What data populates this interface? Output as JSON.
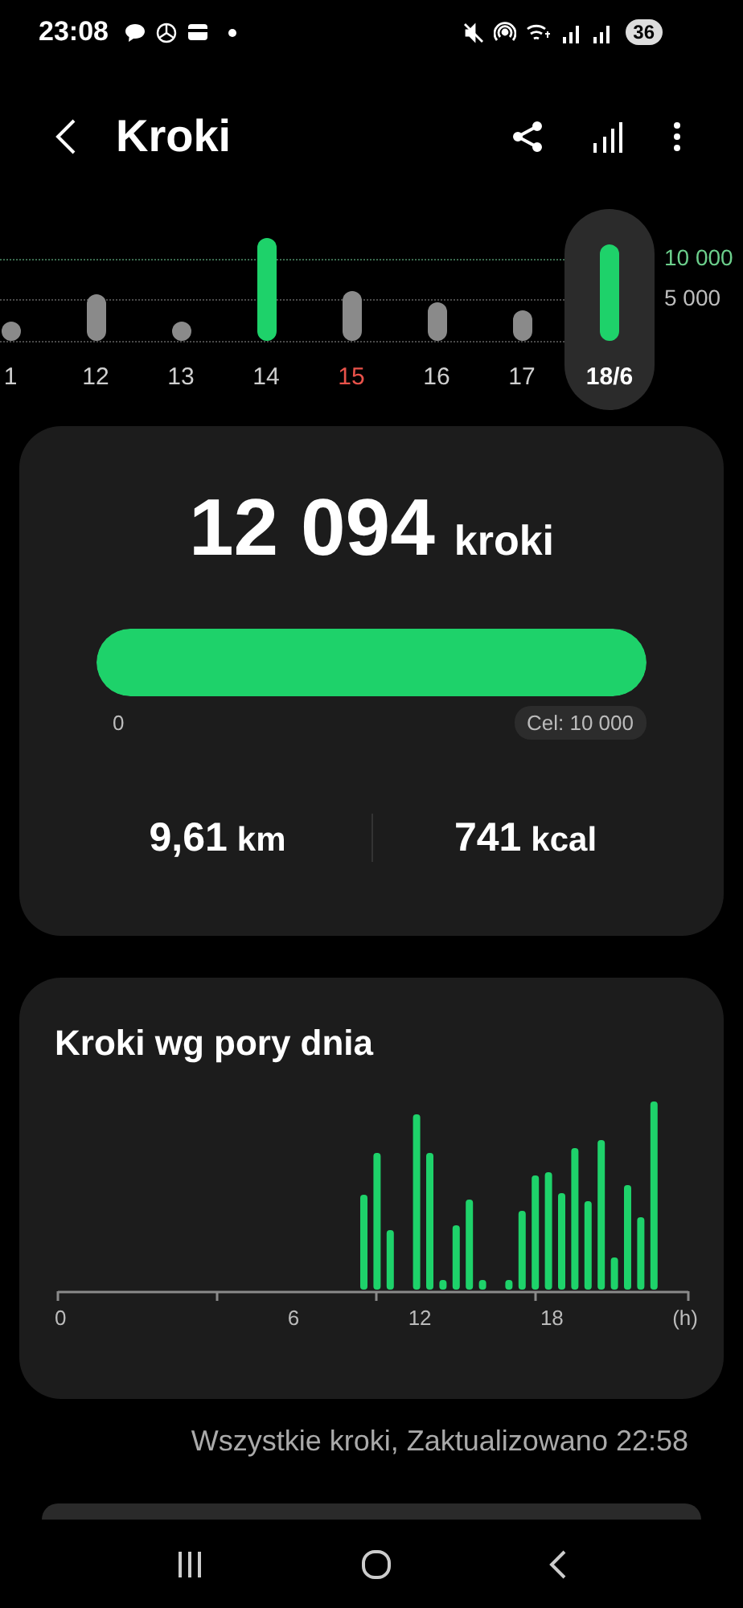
{
  "status_bar": {
    "time": "23:08",
    "battery": "36"
  },
  "header": {
    "title": "Kroki"
  },
  "week": {
    "scale": [
      {
        "label": "10 000",
        "kind": "goal"
      },
      {
        "label": "5 000",
        "kind": "half"
      }
    ],
    "days": [
      {
        "label": "1",
        "goal_met": false,
        "holiday": false,
        "selected": false
      },
      {
        "label": "12",
        "goal_met": false,
        "holiday": false,
        "selected": false
      },
      {
        "label": "13",
        "goal_met": false,
        "holiday": false,
        "selected": false
      },
      {
        "label": "14",
        "goal_met": true,
        "holiday": false,
        "selected": false
      },
      {
        "label": "15",
        "goal_met": false,
        "holiday": true,
        "selected": false
      },
      {
        "label": "16",
        "goal_met": false,
        "holiday": false,
        "selected": false
      },
      {
        "label": "17",
        "goal_met": false,
        "holiday": false,
        "selected": false
      },
      {
        "label": "18/6",
        "goal_met": true,
        "holiday": false,
        "selected": true
      }
    ]
  },
  "summary": {
    "steps": "12 094",
    "unit": "kroki",
    "level": 1,
    "min_label": "0",
    "goal": "Cel: 10 000",
    "stats": [
      {
        "value": "9,61",
        "unit": "km"
      },
      {
        "value": "741",
        "unit": "kcal"
      }
    ]
  },
  "by_time": {
    "title": "Kroki wg pory dnia",
    "axis_labels": [
      "0",
      "6",
      "12",
      "18",
      "(h)"
    ]
  },
  "footer": "Wszystkie kroki, Zaktualizowano 22:58"
}
